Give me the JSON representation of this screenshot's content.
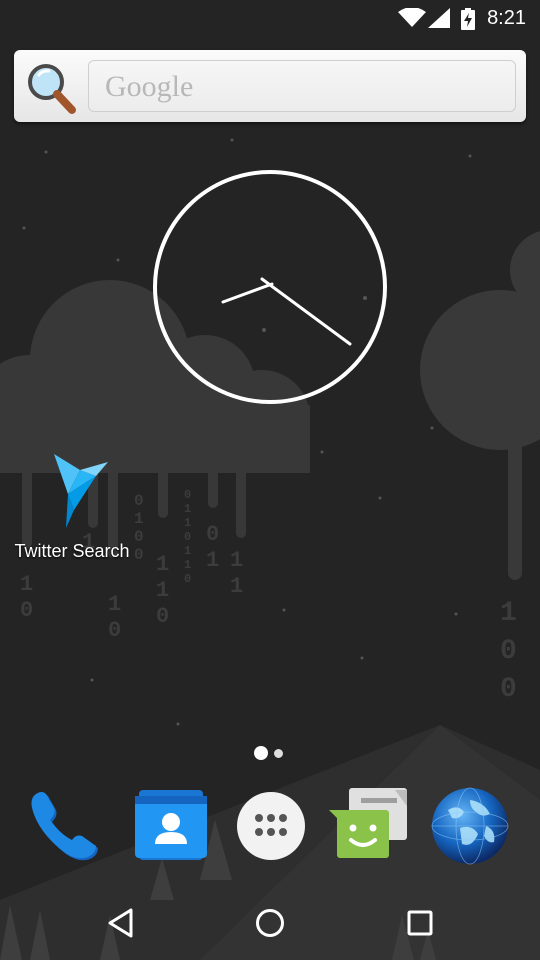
{
  "status_bar": {
    "time": "8:21",
    "icons": [
      "wifi-icon",
      "cell-signal-icon",
      "battery-charging-icon"
    ]
  },
  "search_widget": {
    "placeholder": "Google",
    "icon": "magnifier-icon"
  },
  "clock_widget": {
    "type": "analog",
    "time": "8:21"
  },
  "home_apps": [
    {
      "label": "Twitter Search",
      "icon": "twitter-search-bird-icon"
    }
  ],
  "page_indicator": {
    "pages": 2,
    "current": 1
  },
  "dock": [
    {
      "name": "phone",
      "icon": "phone-icon"
    },
    {
      "name": "contacts",
      "icon": "contacts-icon"
    },
    {
      "name": "app drawer",
      "icon": "app-drawer-icon"
    },
    {
      "name": "messaging",
      "icon": "messaging-icon"
    },
    {
      "name": "browser",
      "icon": "globe-icon"
    }
  ],
  "navigation": [
    "back-icon",
    "home-icon",
    "recents-icon"
  ],
  "wallpaper": {
    "digits_left": [
      "1",
      "0",
      "1",
      "1",
      "0",
      "1",
      "0",
      "0",
      "1",
      "1",
      "1",
      "1",
      "0",
      "1",
      "0",
      "0",
      "0",
      "1",
      "1",
      "0",
      "1",
      "1",
      "0",
      "1",
      "1",
      "1",
      "0",
      "1"
    ],
    "digits_right": [
      "1",
      "0",
      "0"
    ]
  },
  "colors": {
    "background": "#242424",
    "cloud": "#3a3a3a",
    "white": "#ffffff",
    "phone_blue": "#1e88e5",
    "contacts_blue": "#1e88e5",
    "messaging_green": "#8bc34a"
  }
}
